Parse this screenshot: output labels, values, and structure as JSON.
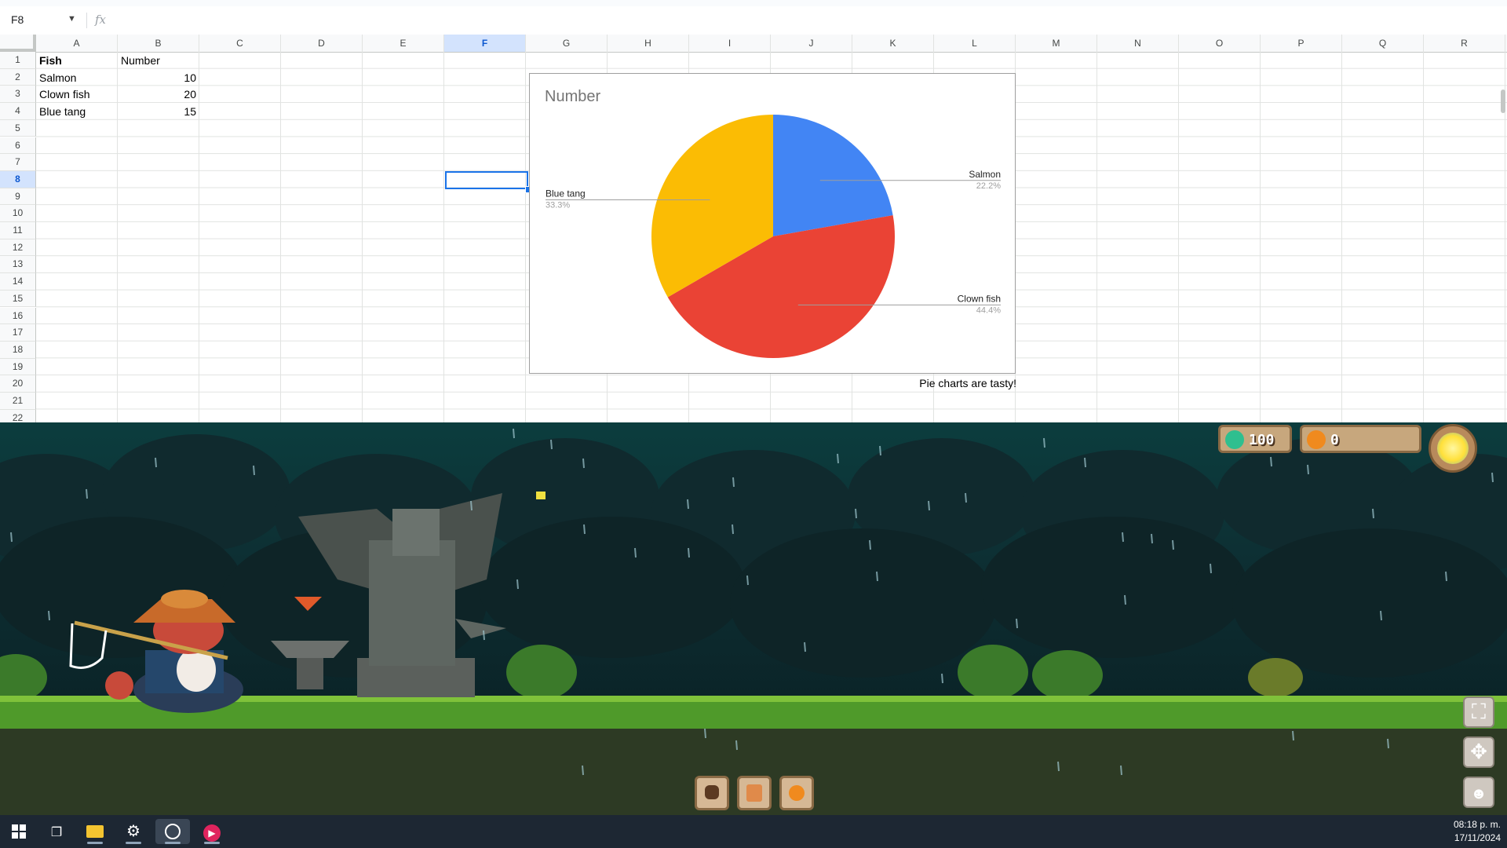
{
  "sheet": {
    "name_box": "F8",
    "formula_icon": "fx",
    "columns": [
      "A",
      "B",
      "C",
      "D",
      "E",
      "F",
      "G",
      "H",
      "I",
      "J",
      "K",
      "L",
      "M",
      "N",
      "O",
      "P",
      "Q",
      "R"
    ],
    "selected_column": "F",
    "rows": [
      "1",
      "2",
      "3",
      "4",
      "5",
      "6",
      "7",
      "8",
      "9",
      "10",
      "11",
      "12",
      "13",
      "14",
      "15",
      "16",
      "17",
      "18",
      "19",
      "20",
      "21",
      "22"
    ],
    "selected_row": "8",
    "table": {
      "headers": [
        "Fish",
        "Number"
      ],
      "rows": [
        {
          "fish": "Salmon",
          "number": "10"
        },
        {
          "fish": "Clown fish",
          "number": "20"
        },
        {
          "fish": "Blue tang",
          "number": "15"
        }
      ]
    },
    "chart_caption": "Pie charts are tasty!"
  },
  "chart_data": {
    "type": "pie",
    "title": "Number",
    "categories": [
      "Salmon",
      "Clown fish",
      "Blue tang"
    ],
    "values": [
      10,
      20,
      15
    ],
    "percent_labels": [
      "22.2%",
      "44.4%",
      "33.3%"
    ],
    "colors": [
      "#4285f4",
      "#ea4335",
      "#fbbc04"
    ],
    "legend": "labels with leader lines"
  },
  "game": {
    "hud": {
      "gems": "100",
      "coins": "0",
      "gem_color": "#2fbf8f",
      "coin_color": "#f08a1e"
    },
    "toolbar_icons": [
      "bag-icon",
      "map-scroll-icon",
      "orange-coin-icon"
    ],
    "side_icons": [
      "fullscreen-icon",
      "move-icon",
      "character-icon"
    ]
  },
  "taskbar": {
    "icons": [
      "windows-start-icon",
      "task-view-icon",
      "file-explorer-icon",
      "settings-icon",
      "obs-icon",
      "media-player-icon"
    ],
    "time": "08:18 p. m.",
    "date": "17/11/2024"
  }
}
